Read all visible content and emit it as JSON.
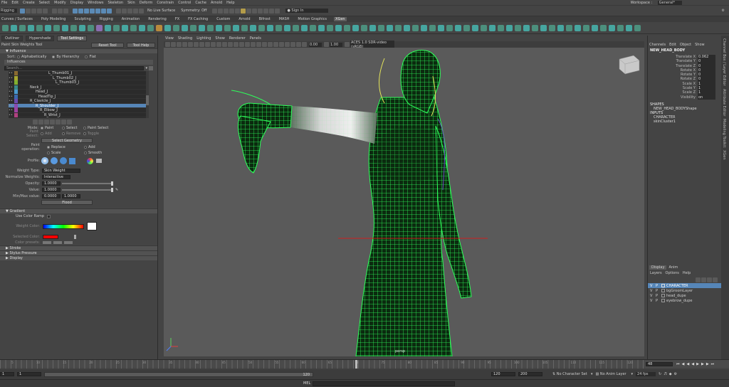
{
  "menubar": [
    "File",
    "Edit",
    "Create",
    "Select",
    "Modify",
    "Display",
    "Windows",
    "Skeleton",
    "Skin",
    "Deform",
    "Constrain",
    "Control",
    "Cache",
    "Arnold",
    "Help"
  ],
  "workspace": {
    "label": "Workspace :",
    "value": "General*"
  },
  "status": {
    "mode": "Rigging",
    "no_live": "No Live Surface",
    "symmetry": "Symmetry: Off",
    "signin": "Sign In"
  },
  "shelf_tabs": [
    "Curves / Surfaces",
    "Poly Modeling",
    "Sculpting",
    "Rigging",
    "Animation",
    "Rendering",
    "FX",
    "FX Caching",
    "Custom",
    "Arnold",
    "Bifrost",
    "MASH",
    "Motion Graphics",
    "XGen"
  ],
  "shelf_active": 13,
  "panel": {
    "tabs": [
      "Outliner",
      "Hypershade",
      "Tool Settings"
    ],
    "active_tab": 2,
    "tool_name": "Paint Skin Weights Tool",
    "reset": "Reset Tool",
    "help": "Tool Help",
    "influence_header": "Influence",
    "sort_label": "Sort:",
    "sort_options": [
      "Alphabetically",
      "By Hierarchy",
      "Flat"
    ],
    "influences_label": "Influences",
    "search_placeholder": "Search...",
    "influences": [
      {
        "name": "L_Thumb01_J",
        "color": "#8a6a30",
        "indent": 56
      },
      {
        "name": "L_Thumb02_J",
        "color": "#a8a830",
        "indent": 62
      },
      {
        "name": "L_Thumb03_J",
        "color": "#80b030",
        "indent": 66
      },
      {
        "name": "Neck_J",
        "color": "#3a8a8a",
        "indent": 30
      },
      {
        "name": "Head_J",
        "color": "#4a9ad0",
        "indent": 38
      },
      {
        "name": "HeadTip_J",
        "color": "#3a6ab0",
        "indent": 42
      },
      {
        "name": "R_Clavicle_J",
        "color": "#6a4ab0",
        "indent": 30
      },
      {
        "name": "R_Shoulder_J",
        "color": "#8a4ab0",
        "indent": 38,
        "selected": true
      },
      {
        "name": "R_Elbow_J",
        "color": "#a040a0",
        "indent": 44
      },
      {
        "name": "R_Wrist_J",
        "color": "#b04080",
        "indent": 50
      }
    ],
    "mode_label": "Mode:",
    "mode_options": [
      "Paint",
      "Select",
      "Paint Select"
    ],
    "paint_select_label": "Paint Select:",
    "paint_select_options": [
      "Add",
      "Remove",
      "Toggle"
    ],
    "select_geometry": "Select Geometry",
    "paint_op_label": "Paint operation:",
    "paint_ops": [
      "Replace",
      "Add",
      "Scale",
      "Smooth"
    ],
    "profile_label": "Profile:",
    "weight_type_label": "Weight Type:",
    "weight_type": "Skin Weight",
    "normalize_label": "Normalize Weights:",
    "normalize": "Interactive",
    "opacity_label": "Opacity:",
    "opacity": "1.0000",
    "value_label": "Value:",
    "value": "1.0000",
    "minmax_label": "Min/Max value:",
    "min": "0.0000",
    "max": "1.0000",
    "flood": "Flood",
    "gradient_header": "Gradient",
    "use_color_ramp": "Use Color Ramp",
    "weight_color_label": "Weight Color:",
    "selected_color_label": "Selected Color:",
    "color_presets_label": "Color presets:",
    "collapsed_sections": [
      "Stroke",
      "Stylus Pressure",
      "Display"
    ]
  },
  "viewport": {
    "menu": [
      "View",
      "Shading",
      "Lighting",
      "Show",
      "Renderer",
      "Panels"
    ],
    "fields": [
      "0.00",
      "1.00"
    ],
    "colorspace": "ACES 1.0 SDR-video (sRGB)",
    "camera": "persp"
  },
  "channelbox": {
    "menu": [
      "Channels",
      "Edit",
      "Object",
      "Show"
    ],
    "object": "NEW_HEAD_BODY",
    "attrs": [
      {
        "n": "Translate X",
        "v": "0.062"
      },
      {
        "n": "Translate Y",
        "v": "0"
      },
      {
        "n": "Translate Z",
        "v": "0"
      },
      {
        "n": "Rotate X",
        "v": "0"
      },
      {
        "n": "Rotate Y",
        "v": "0"
      },
      {
        "n": "Rotate Z",
        "v": "0"
      },
      {
        "n": "Scale X",
        "v": "1"
      },
      {
        "n": "Scale Y",
        "v": "1"
      },
      {
        "n": "Scale Z",
        "v": "1"
      },
      {
        "n": "Visibility",
        "v": "on"
      }
    ],
    "shapes_label": "SHAPES",
    "shape": "NEW_HEAD_BODYShape",
    "inputs_label": "INPUTS",
    "inputs": [
      "CHARACTER",
      "skinCluster1"
    ],
    "side_tabs": [
      "Channel Box / Layer Editor",
      "Attribute Editor",
      "Modeling Toolkit",
      "XGen"
    ]
  },
  "layers": {
    "tabs": [
      "Display",
      "Anim"
    ],
    "menu": [
      "Layers",
      "Options",
      "Help"
    ],
    "items": [
      {
        "name": "CHARACTER",
        "selected": true
      },
      {
        "name": "bgGroomLayer"
      },
      {
        "name": "head_dupe"
      },
      {
        "name": "eyebrow_dupe"
      }
    ]
  },
  "timeline": {
    "ticks": [
      "5",
      "10",
      "15",
      "20",
      "25",
      "30",
      "35",
      "40",
      "45",
      "50",
      "55",
      "60",
      "65",
      "70",
      "75",
      "80",
      "85",
      "90",
      "95",
      "100",
      "105",
      "110",
      "115",
      "120"
    ],
    "current_frame": "48"
  },
  "range": {
    "start": "1",
    "inner_start": "1",
    "inner_end": "120",
    "end": "120",
    "anim_end": "200",
    "no_char": "No Character Set",
    "no_anim": "No Anim Layer",
    "fps": "24 fps"
  },
  "cmd": {
    "lang": "MEL"
  }
}
